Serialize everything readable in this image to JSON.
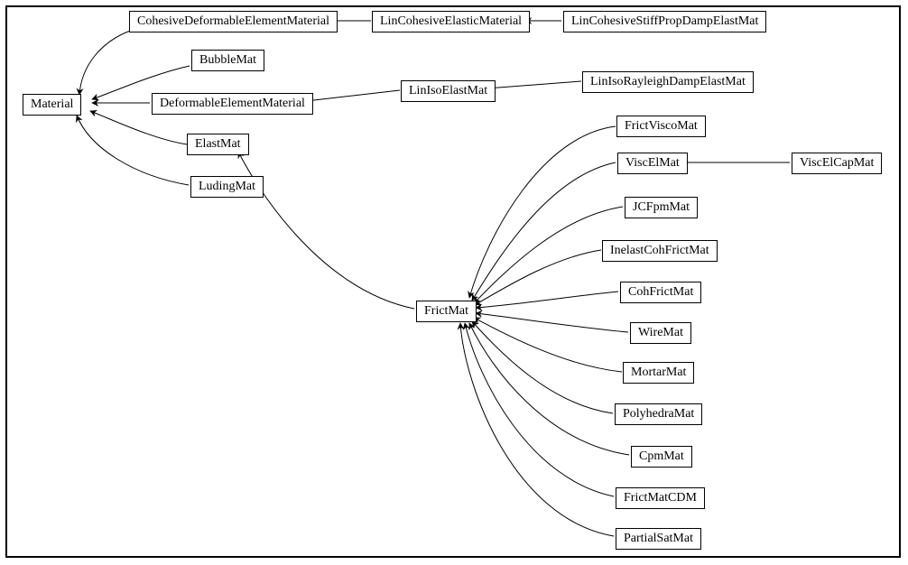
{
  "nodes": {
    "Material": "Material",
    "CohesiveDeformableElementMaterial": "CohesiveDeformableElementMaterial",
    "DeformableElementMaterial": "DeformableElementMaterial",
    "BubbleMat": "BubbleMat",
    "ElastMat": "ElastMat",
    "LudingMat": "LudingMat",
    "LinCohesiveElasticMaterial": "LinCohesiveElasticMaterial",
    "LinCohesiveStiffPropDampElastMat": "LinCohesiveStiffPropDampElastMat",
    "LinIsoElastMat": "LinIsoElastMat",
    "LinIsoRayleighDampElastMat": "LinIsoRayleighDampElastMat",
    "FrictMat": "FrictMat",
    "FrictViscoMat": "FrictViscoMat",
    "ViscElMat": "ViscElMat",
    "ViscElCapMat": "ViscElCapMat",
    "JCFpmMat": "JCFpmMat",
    "InelastCohFrictMat": "InelastCohFrictMat",
    "CohFrictMat": "CohFrictMat",
    "WireMat": "WireMat",
    "MortarMat": "MortarMat",
    "PolyhedraMat": "PolyhedraMat",
    "CpmMat": "CpmMat",
    "FrictMatCDM": "FrictMatCDM",
    "PartialSatMat": "PartialSatMat"
  }
}
